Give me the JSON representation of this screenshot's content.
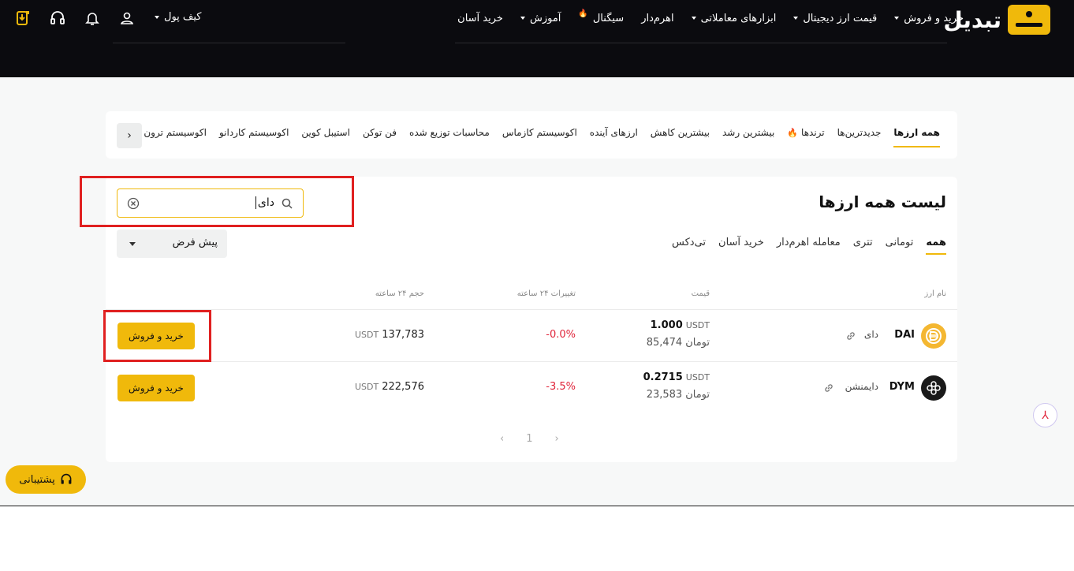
{
  "header": {
    "logo_text": "تبدیل",
    "nav": [
      {
        "label": "خرید و فروش",
        "caret": true
      },
      {
        "label": "قیمت ارز دیجیتال",
        "caret": true
      },
      {
        "label": "ابزارهای معاملاتی",
        "caret": true
      },
      {
        "label": "اهرم‌دار",
        "caret": false
      },
      {
        "label": "سیگنال",
        "caret": false,
        "flame": true
      },
      {
        "label": "آموزش",
        "caret": true
      },
      {
        "label": "خرید آسان",
        "caret": false
      }
    ],
    "wallet_label": "کیف پول",
    "icons": [
      "download-app-icon",
      "headset-icon",
      "bell-icon",
      "user-icon"
    ]
  },
  "category_tabs": {
    "items": [
      "همه ارزها",
      "جدیدترین‌ها",
      "ترندها",
      "بیشترین رشد",
      "بیشترین کاهش",
      "ارزهای آینده",
      "اکوسیستم کازماس",
      "محاسبات توزیع شده",
      "فن توکن",
      "استیبل کوین",
      "اکوسیستم کاردانو",
      "اکوسیستم ترون"
    ],
    "active_index": 0,
    "scroll_glyph": "›"
  },
  "list": {
    "title": "لیست همه ارزها",
    "search": {
      "value": "دای",
      "placeholder": ""
    },
    "sort": {
      "selected": "پیش فرض"
    },
    "market_tabs": [
      "همه",
      "تومانی",
      "تتری",
      "معامله اهرم‌دار",
      "خرید آسان",
      "تی‌دکس"
    ],
    "market_active_index": 0,
    "columns": {
      "name": "نام ارز",
      "price": "قیمت",
      "change": "تغییرات ۲۴ ساعته",
      "volume": "حجم ۲۴ ساعته"
    },
    "rows": [
      {
        "symbol": "DAI",
        "name": "دای",
        "price_usdt": "1.000",
        "price_unit": "USDT",
        "price_toman": "85,474",
        "toman_unit": "تومان",
        "change": "-0.0%",
        "volume": "137,783",
        "volume_unit": "USDT",
        "buy_label": "خرید و فروش",
        "icon_color": "#f4b731"
      },
      {
        "symbol": "DYM",
        "name": "دایمنشن",
        "price_usdt": "0.2715",
        "price_unit": "USDT",
        "price_toman": "23,583",
        "toman_unit": "تومان",
        "change": "-3.5%",
        "volume": "222,576",
        "volume_unit": "USDT",
        "buy_label": "خرید و فروش",
        "icon_color": "#1a1a1a"
      }
    ],
    "pager": {
      "prev": "‹",
      "page": "1",
      "next": "›"
    }
  },
  "support_label": "پشتیبانی",
  "colors": {
    "accent": "#f0b90b",
    "negative": "#e0243a",
    "highlight": "#e02020",
    "header_bg": "#0b0b0f"
  }
}
